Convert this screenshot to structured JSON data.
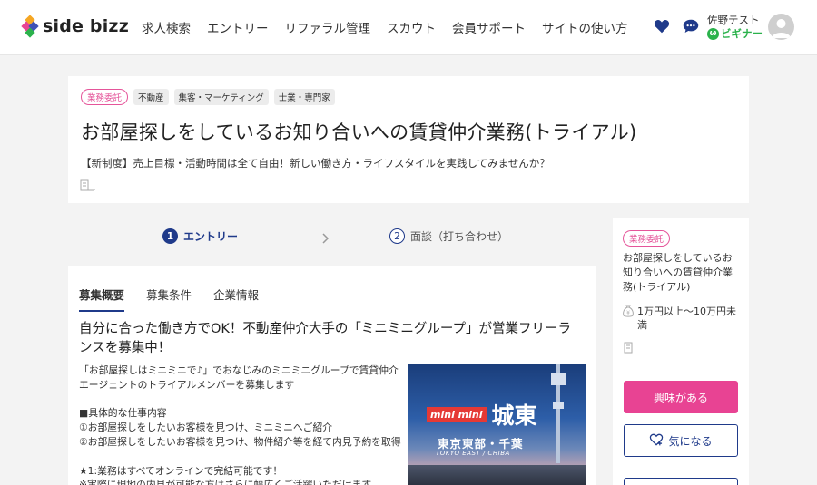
{
  "header": {
    "logo_text": "side bizz",
    "nav": [
      "求人検索",
      "エントリー",
      "リファラル管理",
      "スカウト",
      "会員サポート",
      "サイトの使い方"
    ],
    "user_name": "佐野テスト",
    "user_rank": "ビギナー",
    "rank_badge": "ω"
  },
  "job": {
    "tags": [
      "業務委託",
      "不動産",
      "集客・マーケティング",
      "士業・専門家"
    ],
    "title": "お部屋探しをしているお知り合いへの賃貸仲介業務(トライアル)",
    "subtitle": "【新制度】売上目標・活動時間は全て自由！新しい働き方・ライフスタイルを実践してみませんか？"
  },
  "stepper": {
    "steps": [
      {
        "num": "1",
        "label": "エントリー"
      },
      {
        "num": "2",
        "label": "面談（打ち合わせ）"
      }
    ]
  },
  "main": {
    "tabs": [
      "募集概要",
      "募集条件",
      "企業情報"
    ],
    "headline": "自分に合った働き方でOK！不動産仲介大手の「ミニミニグループ」が営業フリーランスを募集中！",
    "body": "「お部屋探しはミニミニで♪」でおなじみのミニミニグループで賃貸仲介エージェントのトライアルメンバーを募集します\n\n■具体的な仕事内容\n①お部屋探しをしたいお客様を見つけ、ミニミニへご紹介\n②お部屋探しをしたいお客様を見つけ、物件紹介等を経て内見予約を取得\n\n★1:業務はすべてオンラインで完結可能です！\n※実際に現地の内見が可能な方はさらに幅広くご活躍いただけます",
    "banner": {
      "brand": "mini mini",
      "area": "城東",
      "area_sub": "東京東部・千葉",
      "area_en": "TOKYO EAST / CHIBA"
    }
  },
  "side": {
    "tag": "業務委託",
    "title": "お部屋探しをしているお知り合いへの賃貸仲介業務(トライアル)",
    "salary": "1万円以上〜10万円未満",
    "interest_button": "興味がある",
    "favorite_button": "気になる"
  },
  "colors": {
    "accent_pink": "#e84393",
    "navy": "#1f3a8a",
    "rank_green": "#2bb24c"
  }
}
